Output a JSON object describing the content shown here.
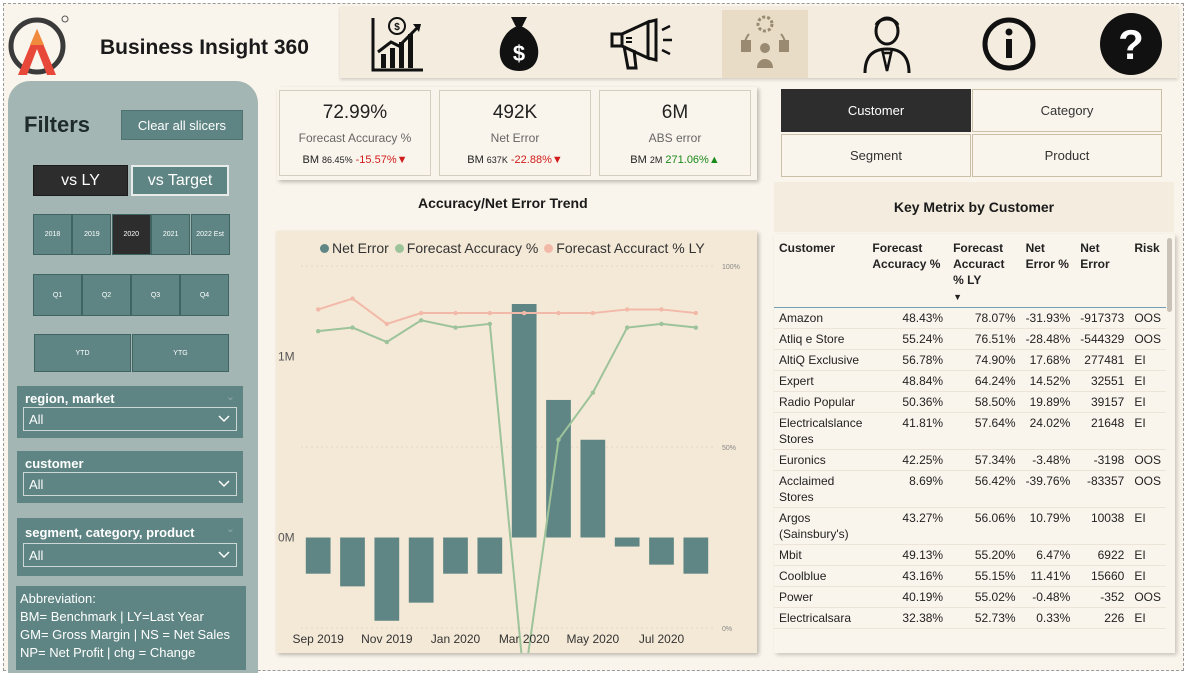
{
  "header": {
    "title": "Business Insight 360",
    "nav": [
      {
        "name": "finance-icon"
      },
      {
        "name": "money-bag-icon"
      },
      {
        "name": "marketing-megaphone-icon"
      },
      {
        "name": "supply-chain-icon",
        "active": true
      },
      {
        "name": "executive-icon"
      },
      {
        "name": "info-icon"
      },
      {
        "name": "help-icon"
      }
    ]
  },
  "filters": {
    "title": "Filters",
    "clear_label": "Clear all slicers",
    "vs_ly": "vs LY",
    "vs_target": "vs Target",
    "years": [
      "2018",
      "2019",
      "2020",
      "2021",
      "2022 Est"
    ],
    "selected_year": "2020",
    "quarters": [
      "Q1",
      "Q2",
      "Q3",
      "Q4"
    ],
    "periods": [
      "YTD",
      "YTG"
    ],
    "slicers": [
      {
        "label": "region, market",
        "value": "All"
      },
      {
        "label": "customer",
        "value": "All"
      },
      {
        "label": "segment, category, product",
        "value": "All"
      }
    ],
    "abbreviation": {
      "title": "Abbreviation:",
      "lines": [
        "BM= Benchmark | LY=Last Year",
        "GM= Gross Margin | NS = Net Sales",
        "NP= Net Profit | chg = Change"
      ]
    }
  },
  "kpis": [
    {
      "value": "72.99%",
      "name": "Forecast Accuracy %",
      "bm_label": "BM",
      "bm_value": "86.45%",
      "change": "-15.57%",
      "dir": "down"
    },
    {
      "value": "492K",
      "name": "Net Error",
      "bm_label": "BM",
      "bm_value": "637K",
      "change": "-22.88%",
      "dir": "down"
    },
    {
      "value": "6M",
      "name": "ABS error",
      "bm_label": "BM",
      "bm_value": "2M",
      "change": "271.06%",
      "dir": "up"
    }
  ],
  "colors": {
    "bar": "#5f8684",
    "accuracy": "#9dc39a",
    "accuracy_ly": "#f2b9a8",
    "teal": "#5e8583",
    "dark": "#2d2d2d",
    "up": "#1a8a1a",
    "down": "#d01c1c"
  },
  "chart": {
    "title": "Accuracy/Net Error Trend",
    "legend": [
      "Net Error",
      "Forecast Accuracy %",
      "Forecast Accuract % LY"
    ],
    "left_ticks": [
      "1M",
      "0M"
    ],
    "right_ticks": [
      "100%",
      "50%",
      "0%"
    ],
    "x_ticks": [
      "Sep 2019",
      "Nov 2019",
      "Jan 2020",
      "Mar 2020",
      "May 2020",
      "Jul 2020"
    ]
  },
  "chart_data": {
    "type": "bar",
    "categories": [
      "Sep 2019",
      "Oct 2019",
      "Nov 2019",
      "Dec 2019",
      "Jan 2020",
      "Feb 2020",
      "Mar 2020",
      "Apr 2020",
      "May 2020",
      "Jun 2020",
      "Jul 2020",
      "Aug 2020"
    ],
    "series": [
      {
        "name": "Net Error",
        "type": "bar",
        "axis": "left",
        "values": [
          -200000,
          -270000,
          -460000,
          -360000,
          -200000,
          -200000,
          1290000,
          760000,
          540000,
          -50000,
          -150000,
          -200000
        ]
      },
      {
        "name": "Forecast Accuracy %",
        "type": "line",
        "axis": "right",
        "values": [
          82,
          83,
          79,
          85,
          83,
          84,
          -15,
          52,
          65,
          83,
          84,
          83
        ]
      },
      {
        "name": "Forecast Accuract % LY",
        "type": "line",
        "axis": "right",
        "values": [
          88,
          91,
          84,
          87,
          87,
          87,
          87,
          87,
          87,
          88,
          88,
          87
        ]
      }
    ],
    "left_ylim": [
      -500000,
      1500000
    ],
    "right_ylim": [
      0,
      100
    ],
    "grid": true,
    "legend_position": "top"
  },
  "tabs": {
    "items": [
      "Customer",
      "Category",
      "Segment",
      "Product"
    ],
    "selected": "Customer"
  },
  "table": {
    "title": "Key Metrix by Customer",
    "columns": [
      "Customer",
      "Forecast Accuracy %",
      "Forecast Accuract % LY",
      "Net Error %",
      "Net Error",
      "Risk"
    ],
    "sort_indicator": "▼",
    "rows": [
      [
        "Amazon",
        "48.43%",
        "78.07%",
        "-31.93%",
        "-917373",
        "OOS"
      ],
      [
        "Atliq e Store",
        "55.24%",
        "76.51%",
        "-28.48%",
        "-544329",
        "OOS"
      ],
      [
        "AltiQ Exclusive",
        "56.78%",
        "74.90%",
        "17.68%",
        "277481",
        "EI"
      ],
      [
        "Expert",
        "48.84%",
        "64.24%",
        "14.52%",
        "32551",
        "EI"
      ],
      [
        "Radio Popular",
        "50.36%",
        "58.50%",
        "19.89%",
        "39157",
        "EI"
      ],
      [
        "Electricalslance Stores",
        "41.81%",
        "57.64%",
        "24.02%",
        "21648",
        "EI"
      ],
      [
        "Euronics",
        "42.25%",
        "57.34%",
        "-3.48%",
        "-3198",
        "OOS"
      ],
      [
        "Acclaimed Stores",
        "8.69%",
        "56.42%",
        "-39.76%",
        "-83357",
        "OOS"
      ],
      [
        "Argos (Sainsbury's)",
        "43.27%",
        "56.06%",
        "10.79%",
        "10038",
        "EI"
      ],
      [
        "Mbit",
        "49.13%",
        "55.20%",
        "6.47%",
        "6922",
        "EI"
      ],
      [
        "Coolblue",
        "43.16%",
        "55.15%",
        "11.41%",
        "15660",
        "EI"
      ],
      [
        "Power",
        "40.19%",
        "55.02%",
        "-0.48%",
        "-352",
        "OOS"
      ],
      [
        "Electricalsara",
        "32.38%",
        "52.73%",
        "0.33%",
        "226",
        "EI"
      ]
    ]
  }
}
